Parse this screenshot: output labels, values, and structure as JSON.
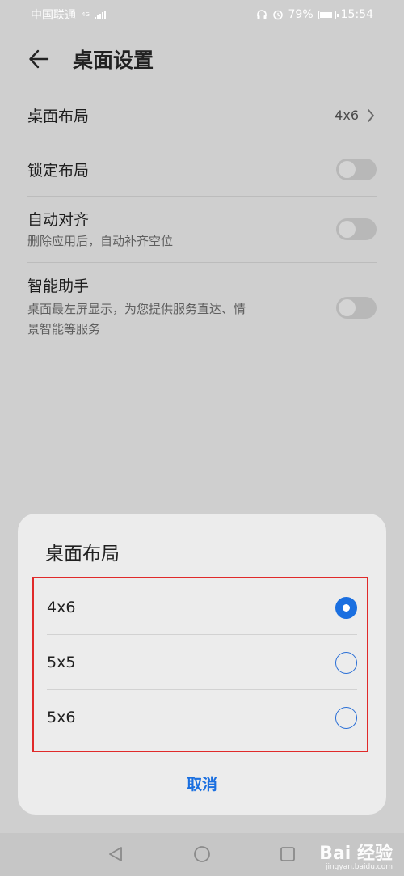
{
  "status_bar": {
    "carrier": "中国联通",
    "network": "4G",
    "battery": "79%",
    "time": "15:54",
    "icons": [
      "signal-icon",
      "headset-icon",
      "alarm-icon",
      "battery-icon"
    ]
  },
  "header": {
    "title": "桌面设置"
  },
  "settings": {
    "layout": {
      "label": "桌面布局",
      "value": "4x6"
    },
    "lock": {
      "label": "锁定布局",
      "enabled": false
    },
    "auto_align": {
      "label": "自动对齐",
      "sub": "删除应用后，自动补齐空位",
      "enabled": false
    },
    "assistant": {
      "label": "智能助手",
      "sub_line1": "桌面最左屏显示，为您提供服务直达、情",
      "sub_line2": "景智能等服务",
      "enabled": false
    }
  },
  "dialog": {
    "title": "桌面布局",
    "options": [
      {
        "label": "4x6",
        "selected": true
      },
      {
        "label": "5x5",
        "selected": false
      },
      {
        "label": "5x6",
        "selected": false
      }
    ],
    "cancel_label": "取消"
  },
  "watermark": {
    "main": "Bai 经验",
    "sub": "jingyan.baidu.com"
  },
  "colors": {
    "accent": "#1a6fe0",
    "highlight_box": "#e02a2a",
    "overlay_bg": "#cfcfcf",
    "dialog_bg": "#ececec"
  }
}
